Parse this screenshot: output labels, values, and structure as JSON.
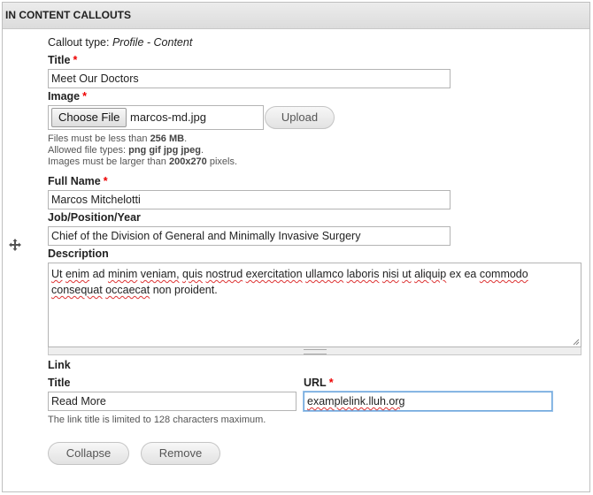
{
  "section": {
    "title": "IN CONTENT CALLOUTS"
  },
  "callout_type": {
    "label": "Callout type:",
    "value": "Profile - Content"
  },
  "title_field": {
    "label": "Title",
    "required_marker": "*",
    "value": "Meet Our Doctors"
  },
  "image_field": {
    "label": "Image",
    "required_marker": "*",
    "choose_label": "Choose File",
    "file_name": "marcos-md.jpg",
    "upload_label": "Upload",
    "help": {
      "size_prefix": "Files must be less than ",
      "size_value": "256 MB",
      "size_suffix": ".",
      "types_prefix": "Allowed file types: ",
      "types_value": "png gif jpg jpeg",
      "types_suffix": ".",
      "dims_prefix": "Images must be larger than ",
      "dims_value": "200x270",
      "dims_suffix": " pixels."
    }
  },
  "full_name_field": {
    "label": "Full Name",
    "required_marker": "*",
    "value": "Marcos Mitchelotti"
  },
  "job_field": {
    "label": "Job/Position/Year",
    "value": "Chief of the Division of General and Minimally Invasive Surgery"
  },
  "description_field": {
    "label": "Description",
    "words": [
      "Ut",
      "enim",
      "ad",
      "minim",
      "veniam,",
      "quis",
      "nostrud",
      "exercitation",
      "ullamco",
      "laboris",
      "nisi",
      "ut",
      "aliquip",
      "ex",
      "ea",
      "commodo",
      "consequat",
      "occaecat",
      "non",
      "proident."
    ]
  },
  "link_group": {
    "label": "Link",
    "title_label": "Title",
    "title_value": "Read More",
    "url_label": "URL",
    "url_required_marker": "*",
    "url_value": "examplelink.lluh.org",
    "help": "The link title is limited to 128 characters maximum."
  },
  "actions": {
    "collapse_label": "Collapse",
    "remove_label": "Remove"
  },
  "icons": {
    "drag": "move-arrows-icon",
    "resize": "resize-grip-icon"
  },
  "colors": {
    "required": "#e00000",
    "header_bg": "#dcdcdc",
    "focus": "#6fa8dc"
  }
}
